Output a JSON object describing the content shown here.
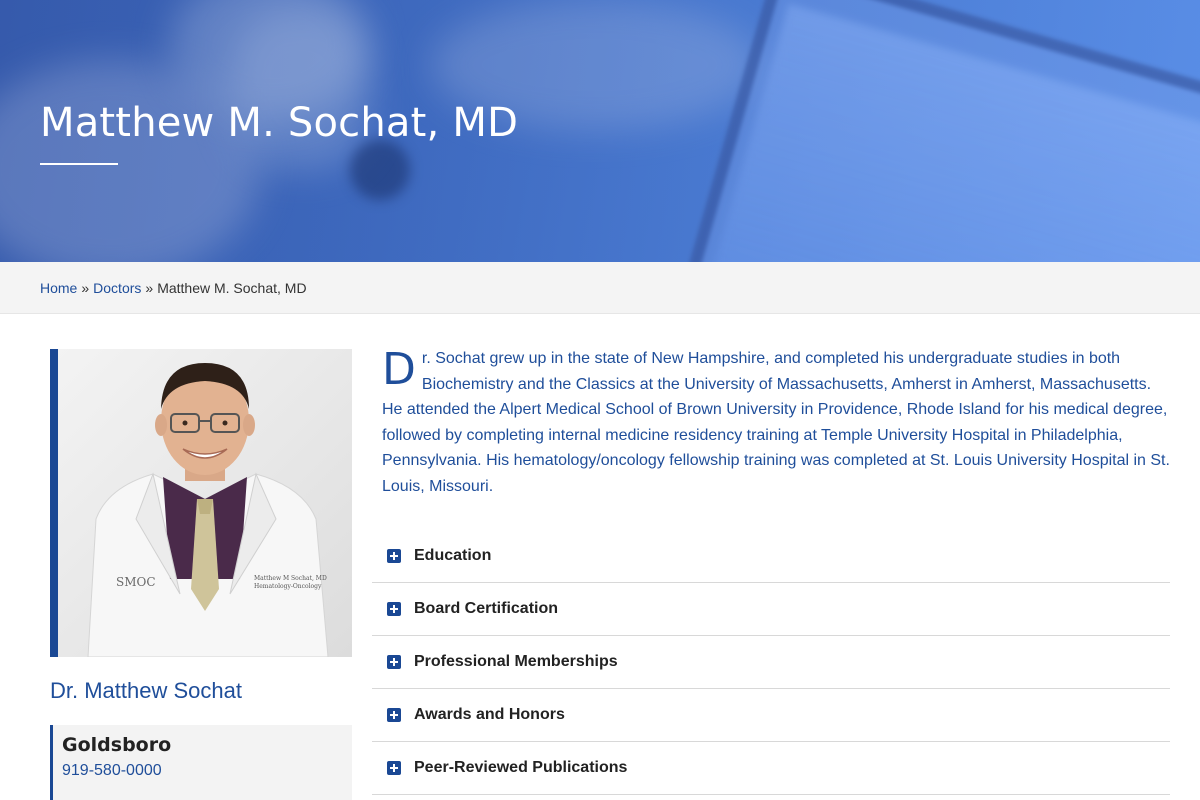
{
  "hero": {
    "title": "Matthew M. Sochat, MD"
  },
  "breadcrumb": {
    "home": "Home",
    "separator": "»",
    "doctors": "Doctors",
    "current": "Matthew M. Sochat, MD"
  },
  "profile": {
    "photo_coat_logo": "SMOC",
    "photo_coat_name": "Matthew M Sochat, MD",
    "photo_coat_dept": "Hematology-Oncology",
    "display_name": "Dr. Matthew Sochat",
    "location": {
      "city": "Goldsboro",
      "phone": "919-580-0000"
    }
  },
  "bio": {
    "dropcap": "D",
    "text": "r. Sochat grew up in the state of New Hampshire, and completed his undergraduate studies in both Biochemistry and the Classics at the University of Massachusetts, Amherst in Amherst, Massachusetts. He attended the Alpert Medical School of Brown University in Providence, Rhode Island for his medical degree, followed by completing internal medicine residency training at Temple University Hospital in Philadelphia, Pennsylvania. His hematology/oncology fellowship training was completed at St. Louis University Hospital in St. Louis, Missouri."
  },
  "accordion": [
    {
      "label": "Education"
    },
    {
      "label": "Board Certification"
    },
    {
      "label": "Professional Memberships"
    },
    {
      "label": "Awards and Honors"
    },
    {
      "label": "Peer-Reviewed Publications"
    }
  ],
  "colors": {
    "primary": "#1a4894",
    "link": "#1f4e9a",
    "breadcrumb_bg": "#f4f4f4"
  },
  "icons": {
    "accordion_toggle": "plus-square-icon"
  }
}
